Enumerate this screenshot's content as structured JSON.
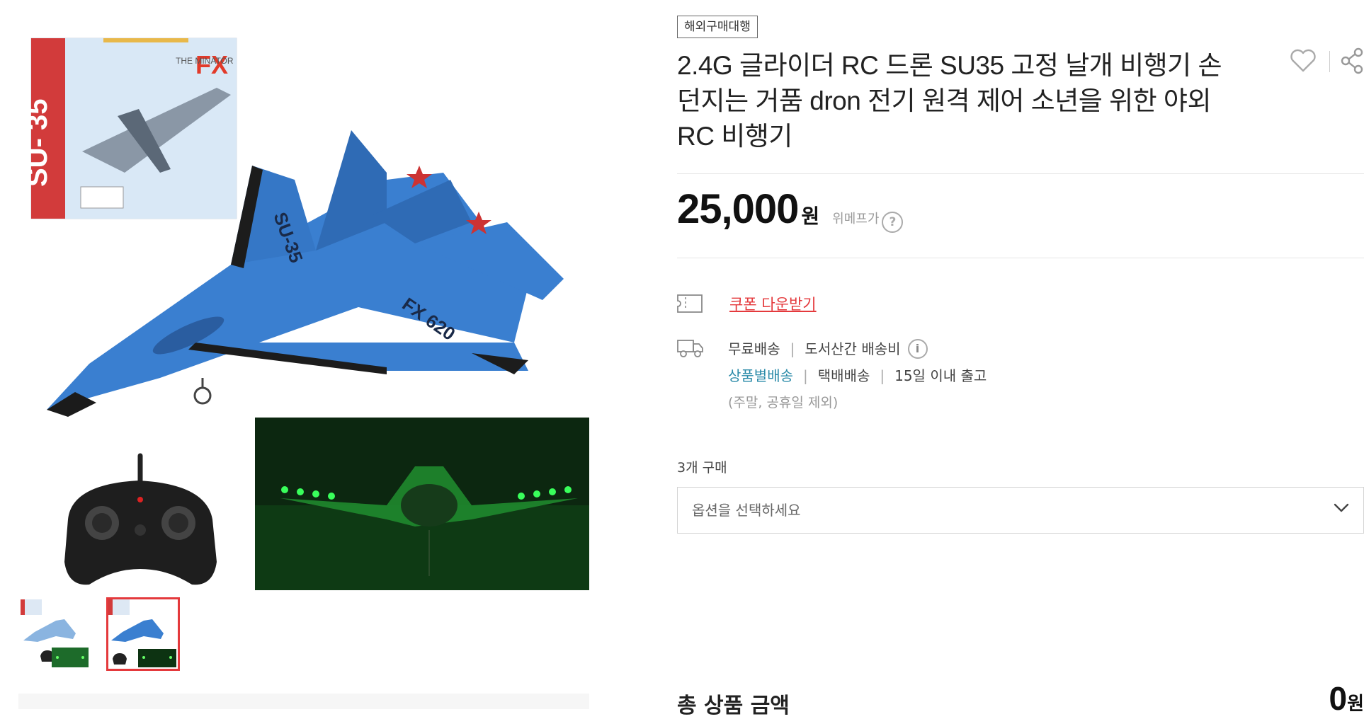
{
  "gallery": {
    "main_image_alt": "SU-35 RC airplane product image",
    "box_text": "SU- 35",
    "box_brand": "FX",
    "box_subtitle": "THE MINATOR",
    "plane_text_top": "SU-35",
    "plane_text_wing": "FX 620",
    "thumbnails": [
      {
        "label": "thumbnail-1",
        "active": false
      },
      {
        "label": "thumbnail-2",
        "active": true
      }
    ]
  },
  "product": {
    "badge": "해외구매대행",
    "title": "2.4G 글라이더 RC 드론 SU35 고정 날개 비행기 손 던지는 거품 dron 전기 원격 제어 소년을 위한 야외 RC 비행기",
    "price": "25,000",
    "price_unit": "원",
    "price_label": "위메프가",
    "help_symbol": "?"
  },
  "coupon": {
    "label": "쿠폰 다운받기"
  },
  "shipping": {
    "fee": "무료배송",
    "remote_fee": "도서산간 배송비",
    "info_symbol": "i",
    "method_by_item": "상품별배송",
    "courier": "택배배송",
    "dispatch": "15일 이내 출고",
    "note": "(주말, 공휴일 제외)"
  },
  "order": {
    "qty_label": "3개 구매",
    "option_placeholder": "옵션을 선택하세요"
  },
  "total": {
    "label": "총 상품 금액",
    "value": "0",
    "unit": "원"
  },
  "colors": {
    "accent_red": "#e4393c",
    "link_blue": "#2a8aa8",
    "plane_blue": "#3a7fd0"
  },
  "icons": [
    "heart-icon",
    "share-icon",
    "coupon-ticket-icon",
    "truck-icon",
    "help-icon",
    "info-icon",
    "chevron-down-icon"
  ]
}
